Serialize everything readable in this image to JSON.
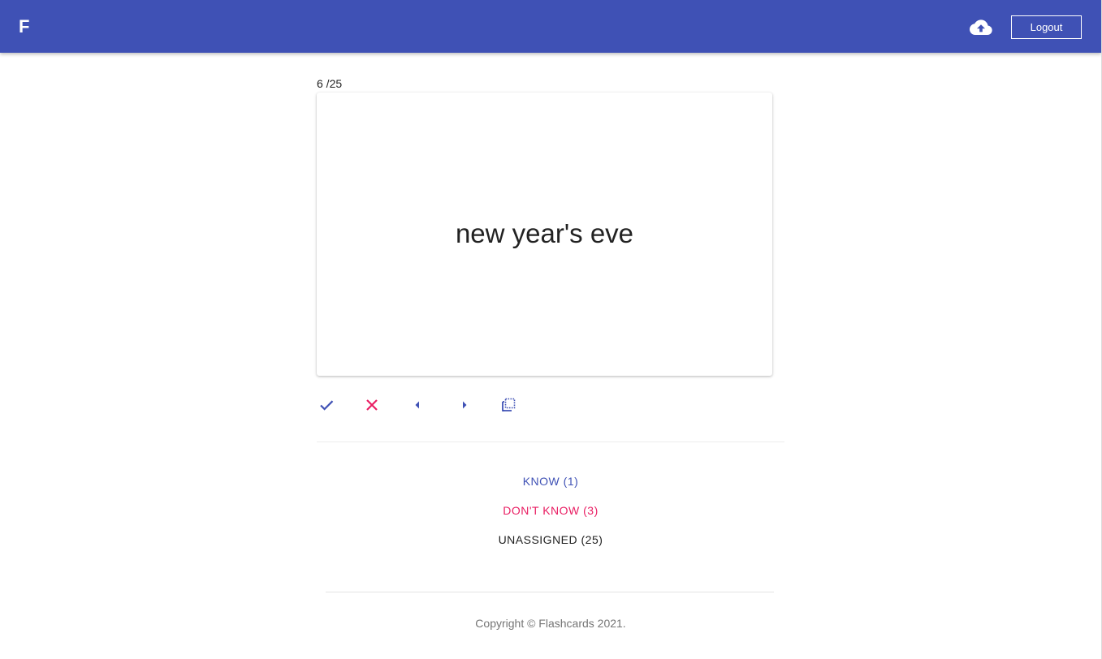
{
  "app": {
    "brand": "F",
    "logout_label": "Logout",
    "upload_icon": "cloud-upload-icon",
    "primary_color": "#3f51b5",
    "accent_color": "#e91e63"
  },
  "study": {
    "counter": "6 /25",
    "card_text": "new year's eve"
  },
  "actions": [
    {
      "name": "know",
      "icon": "check-icon",
      "color": "#3f51b5"
    },
    {
      "name": "dont-know",
      "icon": "close-icon",
      "color": "#e91e63"
    },
    {
      "name": "previous",
      "icon": "caret-left-icon",
      "color": "#3f51b5"
    },
    {
      "name": "next",
      "icon": "caret-right-icon",
      "color": "#3f51b5"
    },
    {
      "name": "flip",
      "icon": "flip-icon",
      "color": "#3f51b5"
    }
  ],
  "filters": {
    "know": "KNOW (1)",
    "dont_know": "DON'T KNOW (3)",
    "unassigned": "UNASSIGNED (25)"
  },
  "footer": {
    "copyright": "Copyright © Flashcards 2021."
  }
}
